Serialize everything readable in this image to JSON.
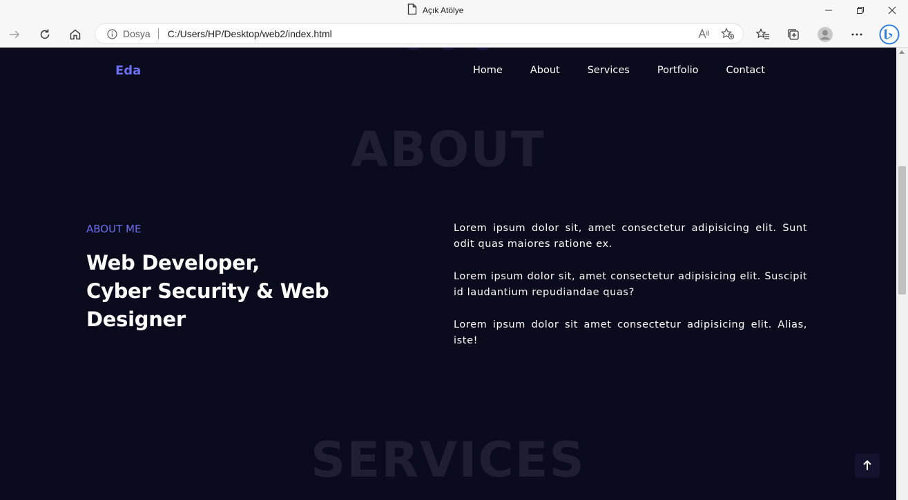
{
  "browser": {
    "tab_title": "Açık Atölye",
    "address": {
      "scheme_label": "Dosya",
      "url": "C:/Users/HP/Desktop/web2/index.html"
    }
  },
  "site": {
    "logo": "Eda",
    "nav": [
      {
        "label": "Home"
      },
      {
        "label": "About"
      },
      {
        "label": "Services"
      },
      {
        "label": "Portfolio"
      },
      {
        "label": "Contact"
      }
    ],
    "about": {
      "ghost_title": "ABOUT",
      "label": "ABOUT ME",
      "heading_lines": [
        "Web Developer,",
        "Cyber Security & Web",
        "Designer"
      ],
      "paragraphs": [
        "Lorem ipsum dolor sit, amet consectetur adipisicing elit. Sunt odit quas maiores ratione ex.",
        "Lorem ipsum dolor sit, amet consectetur adipisicing elit. Suscipit id laudantium repudiandae quas?",
        "Lorem ipsum dolor sit amet consectetur adipisicing elit. Alias, iste!"
      ]
    },
    "services": {
      "ghost_title": "SERVICES"
    }
  },
  "colors": {
    "page_bg": "#0b0b1e",
    "accent": "#6a6ff0",
    "ghost_text": "#1f1f31",
    "text": "#ffffff"
  },
  "icons": {
    "tab": "page-icon",
    "forward": "arrow-right-icon",
    "refresh": "refresh-icon",
    "home": "home-icon",
    "info": "info-icon",
    "read_aloud": "read-aloud-icon",
    "add_favorite": "star-plus-icon",
    "favorites": "favorites-icon",
    "collections": "collections-icon",
    "profile": "profile-avatar-icon",
    "more": "more-dots-icon",
    "bing": "bing-icon",
    "scroll_top": "arrow-up-icon"
  }
}
